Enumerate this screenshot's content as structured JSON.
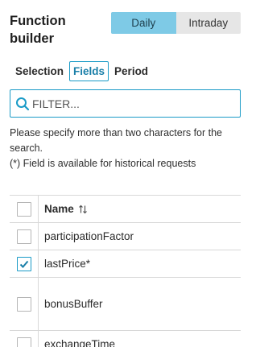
{
  "panel": {
    "title": "Function builder",
    "period_toggle": {
      "options": [
        "Daily",
        "Intraday"
      ],
      "selected": "Daily"
    },
    "tabs": [
      {
        "label": "Selection",
        "active": false
      },
      {
        "label": "Fields",
        "active": true
      },
      {
        "label": "Period",
        "active": false
      }
    ],
    "filter": {
      "placeholder": "FILTER...",
      "value": ""
    },
    "help_line1": "Please specify more than two characters for the search.",
    "help_line2": "(*) Field is available for historical requests",
    "table": {
      "header": {
        "name": "Name",
        "sort_icon": "sort-updown-icon"
      },
      "rows": [
        {
          "name": "participationFactor",
          "checked": false
        },
        {
          "name": "lastPrice*",
          "checked": true
        },
        {
          "name": "bonusBuffer",
          "checked": false
        },
        {
          "name": "exchangeTime",
          "checked": false
        }
      ]
    },
    "colors": {
      "accent": "#1a9bc7",
      "toggle_active": "#7ecae6"
    }
  }
}
